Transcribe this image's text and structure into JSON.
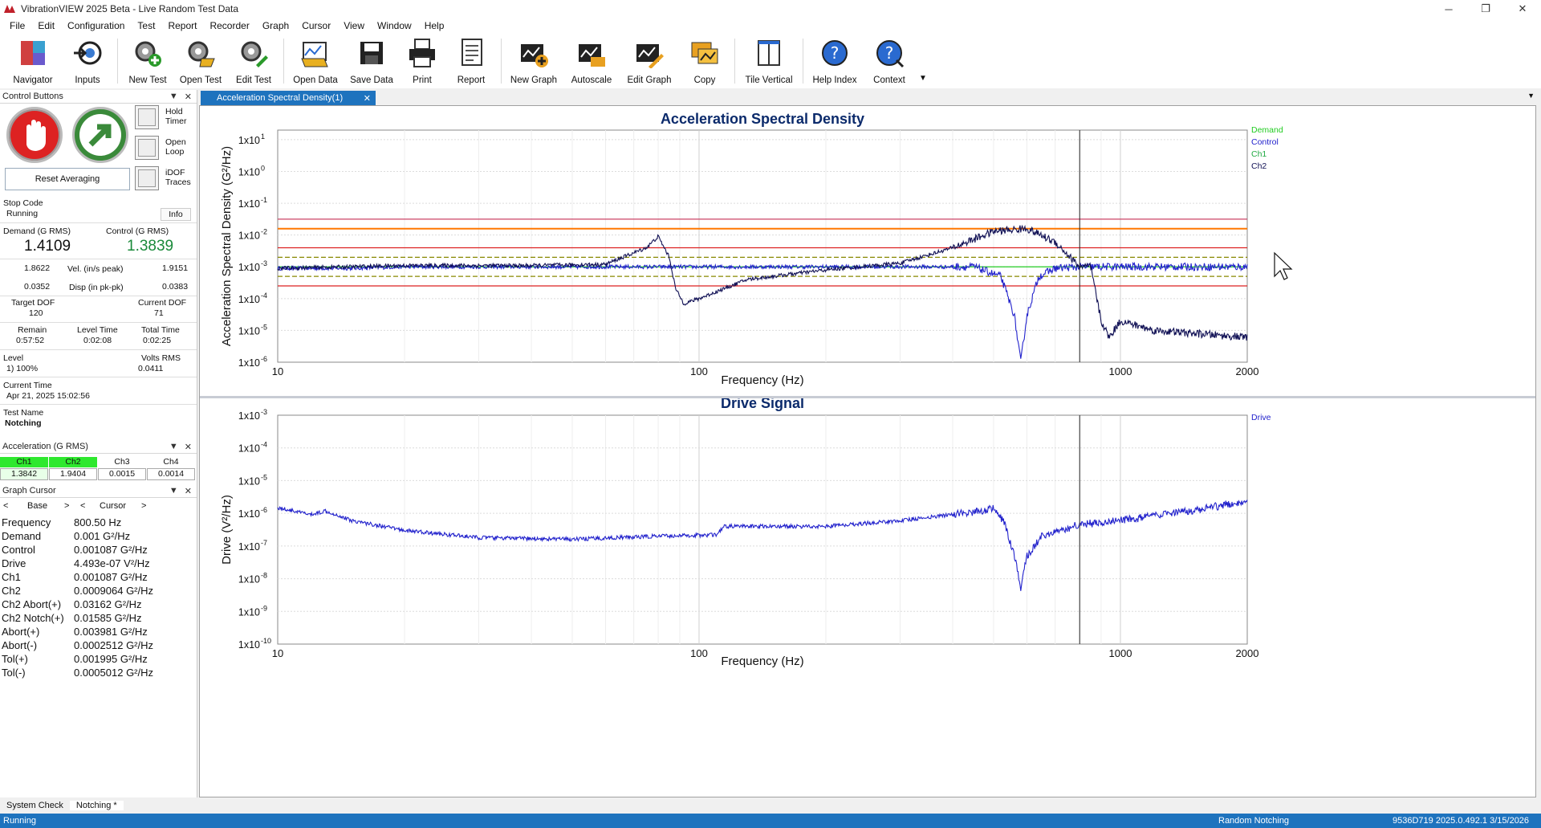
{
  "window": {
    "title": "VibrationVIEW 2025 Beta - Live Random Test Data",
    "min": "─",
    "max": "❐",
    "close": "✕"
  },
  "menu": [
    "File",
    "Edit",
    "Configuration",
    "Test",
    "Report",
    "Recorder",
    "Graph",
    "Cursor",
    "View",
    "Window",
    "Help"
  ],
  "toolbar": [
    {
      "label": "Navigator",
      "icon": "navigator-icon"
    },
    {
      "label": "Inputs",
      "icon": "inputs-icon"
    },
    {
      "label": "New Test",
      "icon": "new-test-icon"
    },
    {
      "label": "Open Test",
      "icon": "open-test-icon"
    },
    {
      "label": "Edit Test",
      "icon": "edit-test-icon"
    },
    {
      "label": "Open Data",
      "icon": "open-data-icon"
    },
    {
      "label": "Save Data",
      "icon": "save-data-icon"
    },
    {
      "label": "Print",
      "icon": "print-icon"
    },
    {
      "label": "Report",
      "icon": "report-icon"
    },
    {
      "label": "New Graph",
      "icon": "new-graph-icon"
    },
    {
      "label": "Autoscale",
      "icon": "autoscale-icon"
    },
    {
      "label": "Edit Graph",
      "icon": "edit-graph-icon"
    },
    {
      "label": "Copy",
      "icon": "copy-icon"
    },
    {
      "label": "Tile Vertical",
      "icon": "tile-vertical-icon"
    },
    {
      "label": "Help Index",
      "icon": "help-index-icon"
    },
    {
      "label": "Context",
      "icon": "context-help-icon"
    }
  ],
  "control_panel": {
    "header": "Control Buttons",
    "hold_timer": "Hold\nTimer",
    "open_loop": "Open\nLoop",
    "idof_traces": "iDOF\nTraces",
    "reset_averaging": "Reset Averaging",
    "stop_code_label": "Stop Code",
    "stop_code": "Running",
    "info": "Info",
    "demand_label": "Demand (G RMS)",
    "demand_value": "1.4109",
    "control_label": "Control (G RMS)",
    "control_value": "1.3839",
    "vel_label": "Vel. (in/s peak)",
    "vel_demand": "1.8622",
    "vel_control": "1.9151",
    "disp_label": "Disp (in pk-pk)",
    "disp_demand": "0.0352",
    "disp_control": "0.0383",
    "target_dof_label": "Target DOF",
    "target_dof": "120",
    "current_dof_label": "Current DOF",
    "current_dof": "71",
    "remain_label": "Remain",
    "remain": "0:57:52",
    "level_time_label": "Level Time",
    "level_time": "0:02:08",
    "total_time_label": "Total Time",
    "total_time": "0:02:25",
    "level_label": "Level",
    "level": "1) 100%",
    "volts_rms_label": "Volts RMS",
    "volts_rms": "0.0411",
    "current_time_label": "Current Time",
    "current_time": "Apr 21, 2025 15:02:56",
    "test_name_label": "Test Name",
    "test_name": "Notching"
  },
  "accel_panel": {
    "header": "Acceleration (G RMS)",
    "channels": [
      {
        "name": "Ch1",
        "value": "1.3842",
        "active": true
      },
      {
        "name": "Ch2",
        "value": "1.9404",
        "active": true
      },
      {
        "name": "Ch3",
        "value": "0.0015",
        "active": false
      },
      {
        "name": "Ch4",
        "value": "0.0014",
        "active": false
      }
    ]
  },
  "cursor_panel": {
    "header": "Graph Cursor",
    "base_label": "Base",
    "cursor_label": "Cursor",
    "prev": "<",
    "next": ">",
    "rows": [
      {
        "name": "Frequency",
        "value": "800.50  Hz"
      },
      {
        "name": "Demand",
        "value": "0.001  G²/Hz"
      },
      {
        "name": "Control",
        "value": "0.001087  G²/Hz"
      },
      {
        "name": "Drive",
        "value": "4.493e-07  V²/Hz"
      },
      {
        "name": "Ch1",
        "value": "0.001087  G²/Hz"
      },
      {
        "name": "Ch2",
        "value": "0.0009064  G²/Hz"
      },
      {
        "name": "Ch2 Abort(+)",
        "value": "0.03162  G²/Hz"
      },
      {
        "name": "Ch2 Notch(+)",
        "value": "0.01585  G²/Hz"
      },
      {
        "name": "Abort(+)",
        "value": "0.003981  G²/Hz"
      },
      {
        "name": "Abort(-)",
        "value": "0.0002512  G²/Hz"
      },
      {
        "name": "Tol(+)",
        "value": "0.001995  G²/Hz"
      },
      {
        "name": "Tol(-)",
        "value": "0.0005012  G²/Hz"
      }
    ]
  },
  "tab": {
    "label": "Acceleration Spectral Density(1)",
    "close": "✕"
  },
  "bottom_tabs": [
    "System Check",
    "Notching *"
  ],
  "status": {
    "left": "Running",
    "center": "Random Notching",
    "right": "9536D719  2025.0.492.1  3/15/2026"
  },
  "colors": {
    "accent": "#1e73be",
    "demand": "#22cc22",
    "control": "#2222cc",
    "ch1": "#22aa44",
    "ch2": "#111155",
    "abort": "#dd2222",
    "notch": "#ff7700",
    "tolerance": "#888800",
    "title": "#0b2a6b"
  },
  "chart_data": [
    {
      "type": "line",
      "title": "Acceleration Spectral Density",
      "xlabel": "Frequency (Hz)",
      "ylabel": "Acceleration Spectral Density (G²/Hz)",
      "x_scale": "log",
      "y_scale": "log",
      "xlim": [
        10,
        2000
      ],
      "ylim": [
        1e-06,
        20
      ],
      "x_ticks": [
        "10",
        "100",
        "1000",
        "2000"
      ],
      "y_ticks": [
        {
          "base": "1x10",
          "exp": "1",
          "v": 10
        },
        {
          "base": "1x10",
          "exp": "0",
          "v": 1
        },
        {
          "base": "1x10",
          "exp": "-1",
          "v": 0.1
        },
        {
          "base": "1x10",
          "exp": "-2",
          "v": 0.01
        },
        {
          "base": "1x10",
          "exp": "-3",
          "v": 0.001
        },
        {
          "base": "1x10",
          "exp": "-4",
          "v": 0.0001
        },
        {
          "base": "1x10",
          "exp": "-5",
          "v": 1e-05
        },
        {
          "base": "1x10",
          "exp": "-6",
          "v": 1e-06
        }
      ],
      "grid": true,
      "legend": [
        "Demand",
        "Control",
        "Ch1",
        "Ch2"
      ],
      "cursor_x": 800.5,
      "limit_lines": [
        {
          "name": "Ch2 Abort(+)",
          "y": 0.03162
        },
        {
          "name": "Ch2 Notch(+)",
          "y": 0.01585
        },
        {
          "name": "Abort(+)",
          "y": 0.003981
        },
        {
          "name": "Tol(+)",
          "y": 0.001995
        },
        {
          "name": "Demand",
          "y": 0.001
        },
        {
          "name": "Tol(-)",
          "y": 0.0005012
        },
        {
          "name": "Abort(-)",
          "y": 0.0002512
        }
      ],
      "series": [
        {
          "name": "Control",
          "points": [
            [
              10,
              0.0009
            ],
            [
              15,
              0.0009
            ],
            [
              20,
              0.001
            ],
            [
              30,
              0.001
            ],
            [
              50,
              0.001
            ],
            [
              70,
              0.001
            ],
            [
              90,
              0.001
            ],
            [
              150,
              0.001
            ],
            [
              300,
              0.001
            ],
            [
              450,
              0.001
            ],
            [
              520,
              0.0005
            ],
            [
              560,
              3e-05
            ],
            [
              580,
              1e-06
            ],
            [
              600,
              3e-05
            ],
            [
              640,
              0.0005
            ],
            [
              700,
              0.0009
            ],
            [
              800,
              0.001
            ],
            [
              2000,
              0.001
            ]
          ]
        },
        {
          "name": "Ch2",
          "points": [
            [
              10,
              0.0009
            ],
            [
              20,
              0.0011
            ],
            [
              40,
              0.0011
            ],
            [
              60,
              0.0012
            ],
            [
              75,
              0.004
            ],
            [
              80,
              0.009
            ],
            [
              85,
              0.002
            ],
            [
              88,
              0.0002
            ],
            [
              92,
              7e-05
            ],
            [
              100,
              0.0001
            ],
            [
              130,
              0.0004
            ],
            [
              200,
              0.0008
            ],
            [
              300,
              0.0013
            ],
            [
              400,
              0.004
            ],
            [
              500,
              0.013
            ],
            [
              600,
              0.016
            ],
            [
              700,
              0.006
            ],
            [
              800,
              0.001
            ],
            [
              850,
              0.001
            ],
            [
              900,
              2e-05
            ],
            [
              940,
              6e-06
            ],
            [
              1000,
              2e-05
            ],
            [
              1200,
              1e-05
            ],
            [
              1500,
              8e-06
            ],
            [
              2000,
              6e-06
            ]
          ]
        }
      ]
    },
    {
      "type": "line",
      "title": "Drive Signal",
      "xlabel": "Frequency (Hz)",
      "ylabel": "Drive (V²/Hz)",
      "x_scale": "log",
      "y_scale": "log",
      "xlim": [
        10,
        2000
      ],
      "ylim": [
        1e-10,
        0.001
      ],
      "x_ticks": [
        "10",
        "100",
        "1000",
        "2000"
      ],
      "y_ticks": [
        {
          "base": "1x10",
          "exp": "-3",
          "v": 0.001
        },
        {
          "base": "1x10",
          "exp": "-4",
          "v": 0.0001
        },
        {
          "base": "1x10",
          "exp": "-5",
          "v": 1e-05
        },
        {
          "base": "1x10",
          "exp": "-6",
          "v": 1e-06
        },
        {
          "base": "1x10",
          "exp": "-7",
          "v": 1e-07
        },
        {
          "base": "1x10",
          "exp": "-8",
          "v": 1e-08
        },
        {
          "base": "1x10",
          "exp": "-9",
          "v": 1e-09
        },
        {
          "base": "1x10",
          "exp": "-10",
          "v": 1e-10
        }
      ],
      "grid": true,
      "legend": [
        "Drive"
      ],
      "cursor_x": 800.5,
      "series": [
        {
          "name": "Drive",
          "points": [
            [
              10,
              1.5e-06
            ],
            [
              12,
              9e-07
            ],
            [
              13,
              1.2e-06
            ],
            [
              15,
              6e-07
            ],
            [
              20,
              3e-07
            ],
            [
              30,
              1.8e-07
            ],
            [
              50,
              1.6e-07
            ],
            [
              80,
              2e-07
            ],
            [
              110,
              2.2e-07
            ],
            [
              115,
              4e-07
            ],
            [
              200,
              4e-07
            ],
            [
              300,
              6e-07
            ],
            [
              450,
              1.1e-06
            ],
            [
              500,
              1.4e-06
            ],
            [
              530,
              5e-07
            ],
            [
              560,
              5e-08
            ],
            [
              580,
              5e-09
            ],
            [
              600,
              5e-08
            ],
            [
              650,
              2e-07
            ],
            [
              800,
              4.5e-07
            ],
            [
              1000,
              6e-07
            ],
            [
              1500,
              1.2e-06
            ],
            [
              2000,
              2.5e-06
            ]
          ]
        }
      ]
    }
  ]
}
